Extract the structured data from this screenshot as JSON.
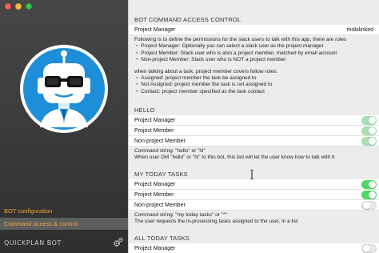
{
  "sidebar": {
    "items": [
      {
        "label": "BOT configuration"
      },
      {
        "label": "Command access & control"
      }
    ],
    "brand": "QUICKPLAN BOT"
  },
  "sections": {
    "access": {
      "header": "BOT COMMAND ACCESS CONTROL",
      "row_label": "Project Manager",
      "row_value": "mobilinked",
      "lines": [
        "Following is to define the permissions for the slack users to talk with this app, there are roles",
        "・ Project Manager: Optionally you can select a slack user as the project manager",
        "・ Project Member: Slack user who is also a project member, matched by email account",
        "・ Non-project Member: Slack user who is NOT a project member",
        "",
        "when talking about a task, project member covers follow roles:",
        "・ Assigned: project member the task be assigned to",
        "・ Not Assigned: project member the task is not assigned to",
        "・ Contact: project member specified as the task contact"
      ]
    },
    "hello": {
      "header": "HELLO",
      "rows": [
        {
          "label": "Project Manager",
          "state": "on-faded"
        },
        {
          "label": "Project Member",
          "state": "on-faded"
        },
        {
          "label": "Non-project Member",
          "state": "on-faded"
        }
      ],
      "lines": [
        "Command string: \"hello\" or \"hi\"",
        "When user DM \"hello\" or \"hi\" to this bot, this bot will let the user know how to talk with it"
      ]
    },
    "today": {
      "header": "MY TODAY TASKS",
      "rows": [
        {
          "label": "Project Manager",
          "state": "on"
        },
        {
          "label": "Project Member",
          "state": "on"
        },
        {
          "label": "Non-project Member",
          "state": "off"
        }
      ],
      "lines": [
        "Command string: \"my today tasks\" or \"*\"",
        "The user requests the in-processing tasks assigned to the user, in a list"
      ]
    },
    "all_today": {
      "header": "ALL TODAY TASKS",
      "rows": [
        {
          "label": "Project Manager",
          "state": "off"
        }
      ]
    }
  },
  "colors": {
    "accent": "#f0a43a",
    "toggle_on": "#4cd964",
    "toggle_faded": "#a8dfb3",
    "logo_blue": "#1e8ed8"
  },
  "icons": [
    "window-close-icon",
    "window-minimize-icon",
    "window-maximize-icon",
    "bot-logo-icon",
    "gear-icon",
    "mouse-cursor-icon"
  ]
}
